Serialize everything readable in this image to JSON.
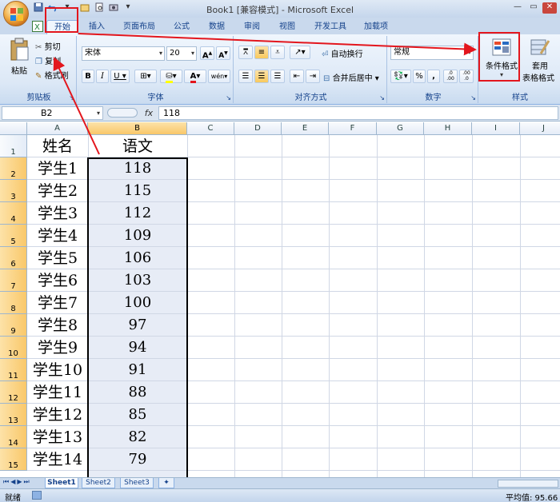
{
  "window": {
    "title": "Book1  [兼容模式] - Microsoft Excel"
  },
  "tabs": [
    "开始",
    "插入",
    "页面布局",
    "公式",
    "数据",
    "审阅",
    "视图",
    "开发工具",
    "加载项"
  ],
  "ribbon": {
    "clipboard": {
      "paste": "粘贴",
      "cut": "剪切",
      "copy": "复制",
      "format_painter": "格式刷",
      "label": "剪贴板"
    },
    "font": {
      "font_name": "宋体",
      "font_size": "20",
      "grow": "A",
      "shrink": "A",
      "bold": "B",
      "italic": "I",
      "underline": "U",
      "font_color": "A",
      "phonetic": "wén",
      "label": "字体"
    },
    "alignment": {
      "wrap": "自动换行",
      "merge": "合并后居中",
      "label": "对齐方式"
    },
    "number": {
      "format": "常规",
      "percent": "%",
      "comma": ",",
      "inc_dec": ".0\n.00",
      "dec_dec": ".00\n.0",
      "label": "数字"
    },
    "styles": {
      "conditional_format": "条件格式",
      "table_format_1": "套用",
      "table_format_2": "表格格式",
      "label": "样式"
    }
  },
  "formula_bar": {
    "name_box": "B2",
    "fx": "fx",
    "content": "118"
  },
  "columns": [
    "A",
    "B",
    "C",
    "D",
    "E",
    "F",
    "G",
    "H",
    "I",
    "J"
  ],
  "rows": [
    {
      "num": "1",
      "a": "姓名",
      "b": "语文"
    },
    {
      "num": "2",
      "a": "学生1",
      "b": "118"
    },
    {
      "num": "3",
      "a": "学生2",
      "b": "115"
    },
    {
      "num": "4",
      "a": "学生3",
      "b": "112"
    },
    {
      "num": "5",
      "a": "学生4",
      "b": "109"
    },
    {
      "num": "6",
      "a": "学生5",
      "b": "106"
    },
    {
      "num": "7",
      "a": "学生6",
      "b": "103"
    },
    {
      "num": "8",
      "a": "学生7",
      "b": "100"
    },
    {
      "num": "9",
      "a": "学生8",
      "b": "97"
    },
    {
      "num": "10",
      "a": "学生9",
      "b": "94"
    },
    {
      "num": "11",
      "a": "学生10",
      "b": "91"
    },
    {
      "num": "12",
      "a": "学生11",
      "b": "88"
    },
    {
      "num": "13",
      "a": "学生12",
      "b": "85"
    },
    {
      "num": "14",
      "a": "学生13",
      "b": "82"
    },
    {
      "num": "15",
      "a": "学生14",
      "b": "79"
    }
  ],
  "sheets": [
    "Sheet1",
    "Sheet2",
    "Sheet3"
  ],
  "status": {
    "mode": "就绪",
    "average": "平均值: 95.66"
  },
  "colors": {
    "annotation_red": "#e3161d",
    "selection_fill": "#e7ecf6",
    "header_highlight": "#f9c86a"
  }
}
